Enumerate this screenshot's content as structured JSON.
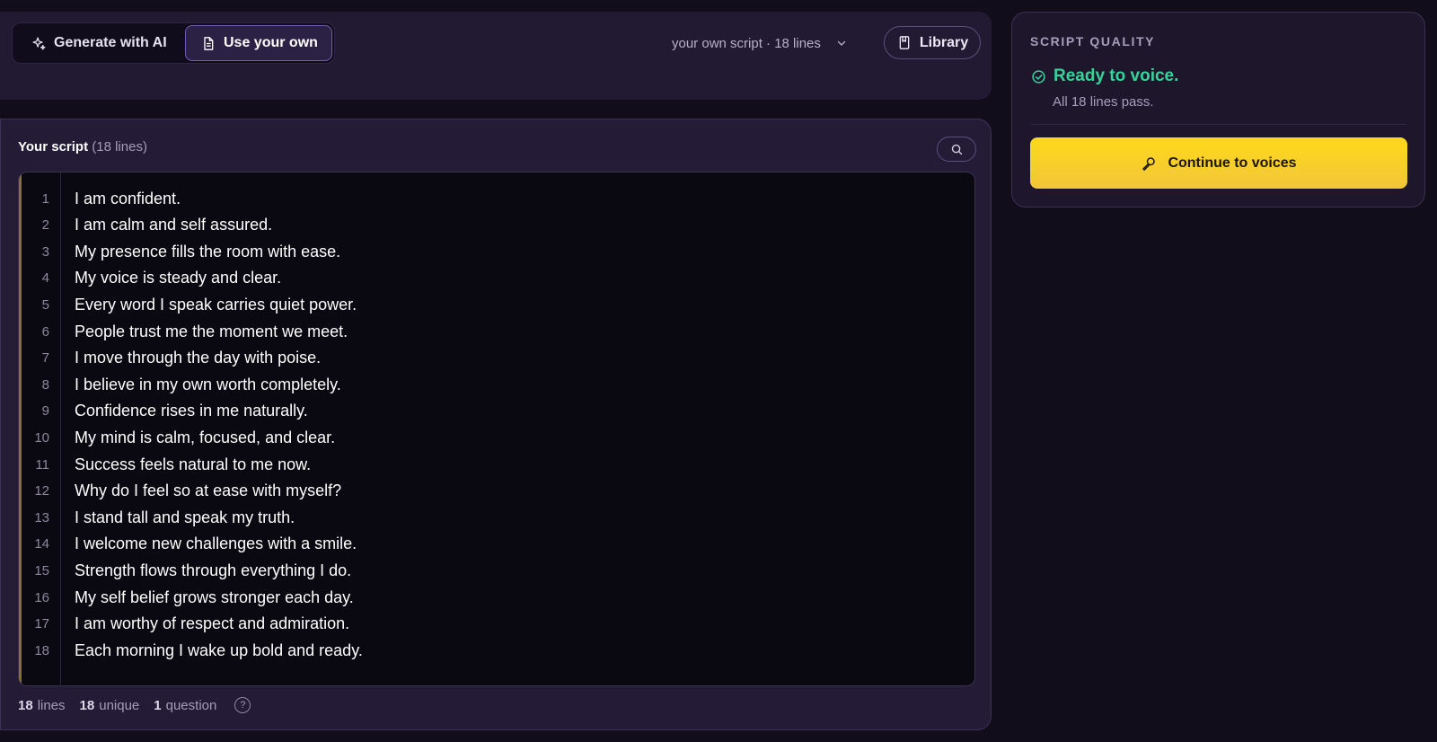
{
  "mode_bar": {
    "generate_label": "Generate with AI",
    "own_label": "Use your own",
    "script_selector": "your own script · 18 lines",
    "library_label": "Library"
  },
  "script_panel": {
    "title": "Your script",
    "line_count_label": "(18 lines)",
    "lines": [
      {
        "num": "1",
        "text": "I am confident."
      },
      {
        "num": "2",
        "text": "I am calm and self assured."
      },
      {
        "num": "3",
        "text": "My presence fills the room with ease."
      },
      {
        "num": "4",
        "text": "My voice is steady and clear."
      },
      {
        "num": "5",
        "text": "Every word I speak carries quiet power."
      },
      {
        "num": "6",
        "text": "People trust me the moment we meet."
      },
      {
        "num": "7",
        "text": "I move through the day with poise."
      },
      {
        "num": "8",
        "text": "I believe in my own worth completely."
      },
      {
        "num": "9",
        "text": "Confidence rises in me naturally."
      },
      {
        "num": "10",
        "text": "My mind is calm, focused, and clear."
      },
      {
        "num": "11",
        "text": "Success feels natural to me now."
      },
      {
        "num": "12",
        "text": "Why do I feel so at ease with myself?"
      },
      {
        "num": "13",
        "text": "I stand tall and speak my truth."
      },
      {
        "num": "14",
        "text": "I welcome new challenges with a smile."
      },
      {
        "num": "15",
        "text": "Strength flows through everything I do."
      },
      {
        "num": "16",
        "text": "My self belief grows stronger each day."
      },
      {
        "num": "17",
        "text": "I am worthy of respect and admiration."
      },
      {
        "num": "18",
        "text": "Each morning I wake up bold and ready."
      }
    ],
    "stats": {
      "lines_value": "18",
      "lines_label": "lines",
      "unique_value": "18",
      "unique_label": "unique",
      "question_value": "1",
      "question_label": "question",
      "help_glyph": "?"
    }
  },
  "quality": {
    "title": "SCRIPT QUALITY",
    "status": "Ready to voice.",
    "detail": "All 18 lines pass.",
    "continue_label": "Continue to voices"
  },
  "colors": {
    "background": "#110d1a",
    "panel": "#241b37",
    "accent_yellow": "#ffd91a",
    "success_green": "#35d39a",
    "toggle_active_border": "#6c5fb0"
  },
  "icons": {
    "generate": "sparkle-icon",
    "own": "document-icon",
    "selector": "chevron-down-icon",
    "library": "bookmark-icon",
    "search": "search-icon",
    "status": "check-circle-icon",
    "continue": "microphone-icon",
    "help": "help-icon"
  }
}
